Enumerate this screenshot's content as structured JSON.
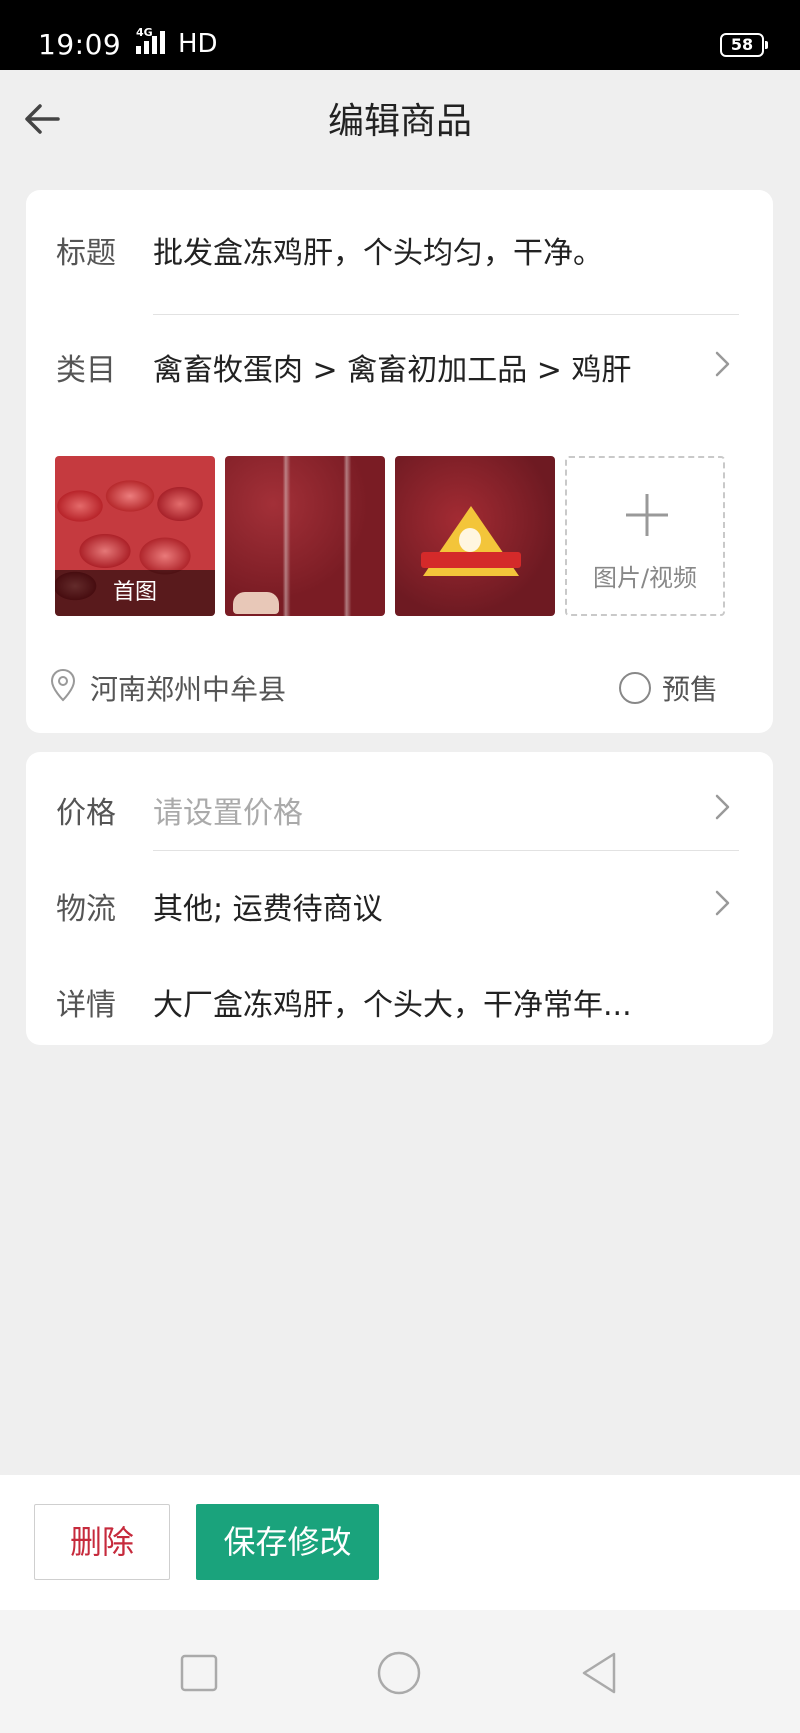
{
  "status_bar": {
    "time": "19:09",
    "network": "4G",
    "hd": "HD",
    "battery": "58"
  },
  "header": {
    "title": "编辑商品"
  },
  "product": {
    "title_label": "标题",
    "title_value": "批发盒冻鸡肝，个头均匀，干净。",
    "category_label": "类目",
    "category_value": "禽畜牧蛋肉 > 禽畜初加工品 > 鸡肝",
    "images": [
      {
        "caption": "首图"
      },
      {
        "caption": ""
      },
      {
        "caption": ""
      }
    ],
    "add_media_label": "图片/视频",
    "location": "河南郑州中牟县",
    "presale_label": "预售",
    "presale_checked": false
  },
  "details": {
    "price_label": "价格",
    "price_placeholder": "请设置价格",
    "logistics_label": "物流",
    "logistics_value": "其他; 运费待商议",
    "detail_label": "详情",
    "detail_value": "大厂盒冻鸡肝，个头大，干净常年..."
  },
  "footer": {
    "delete_label": "删除",
    "save_label": "保存修改"
  },
  "colors": {
    "accent": "#1aa37c",
    "danger": "#c62a3c",
    "background": "#efefef"
  }
}
